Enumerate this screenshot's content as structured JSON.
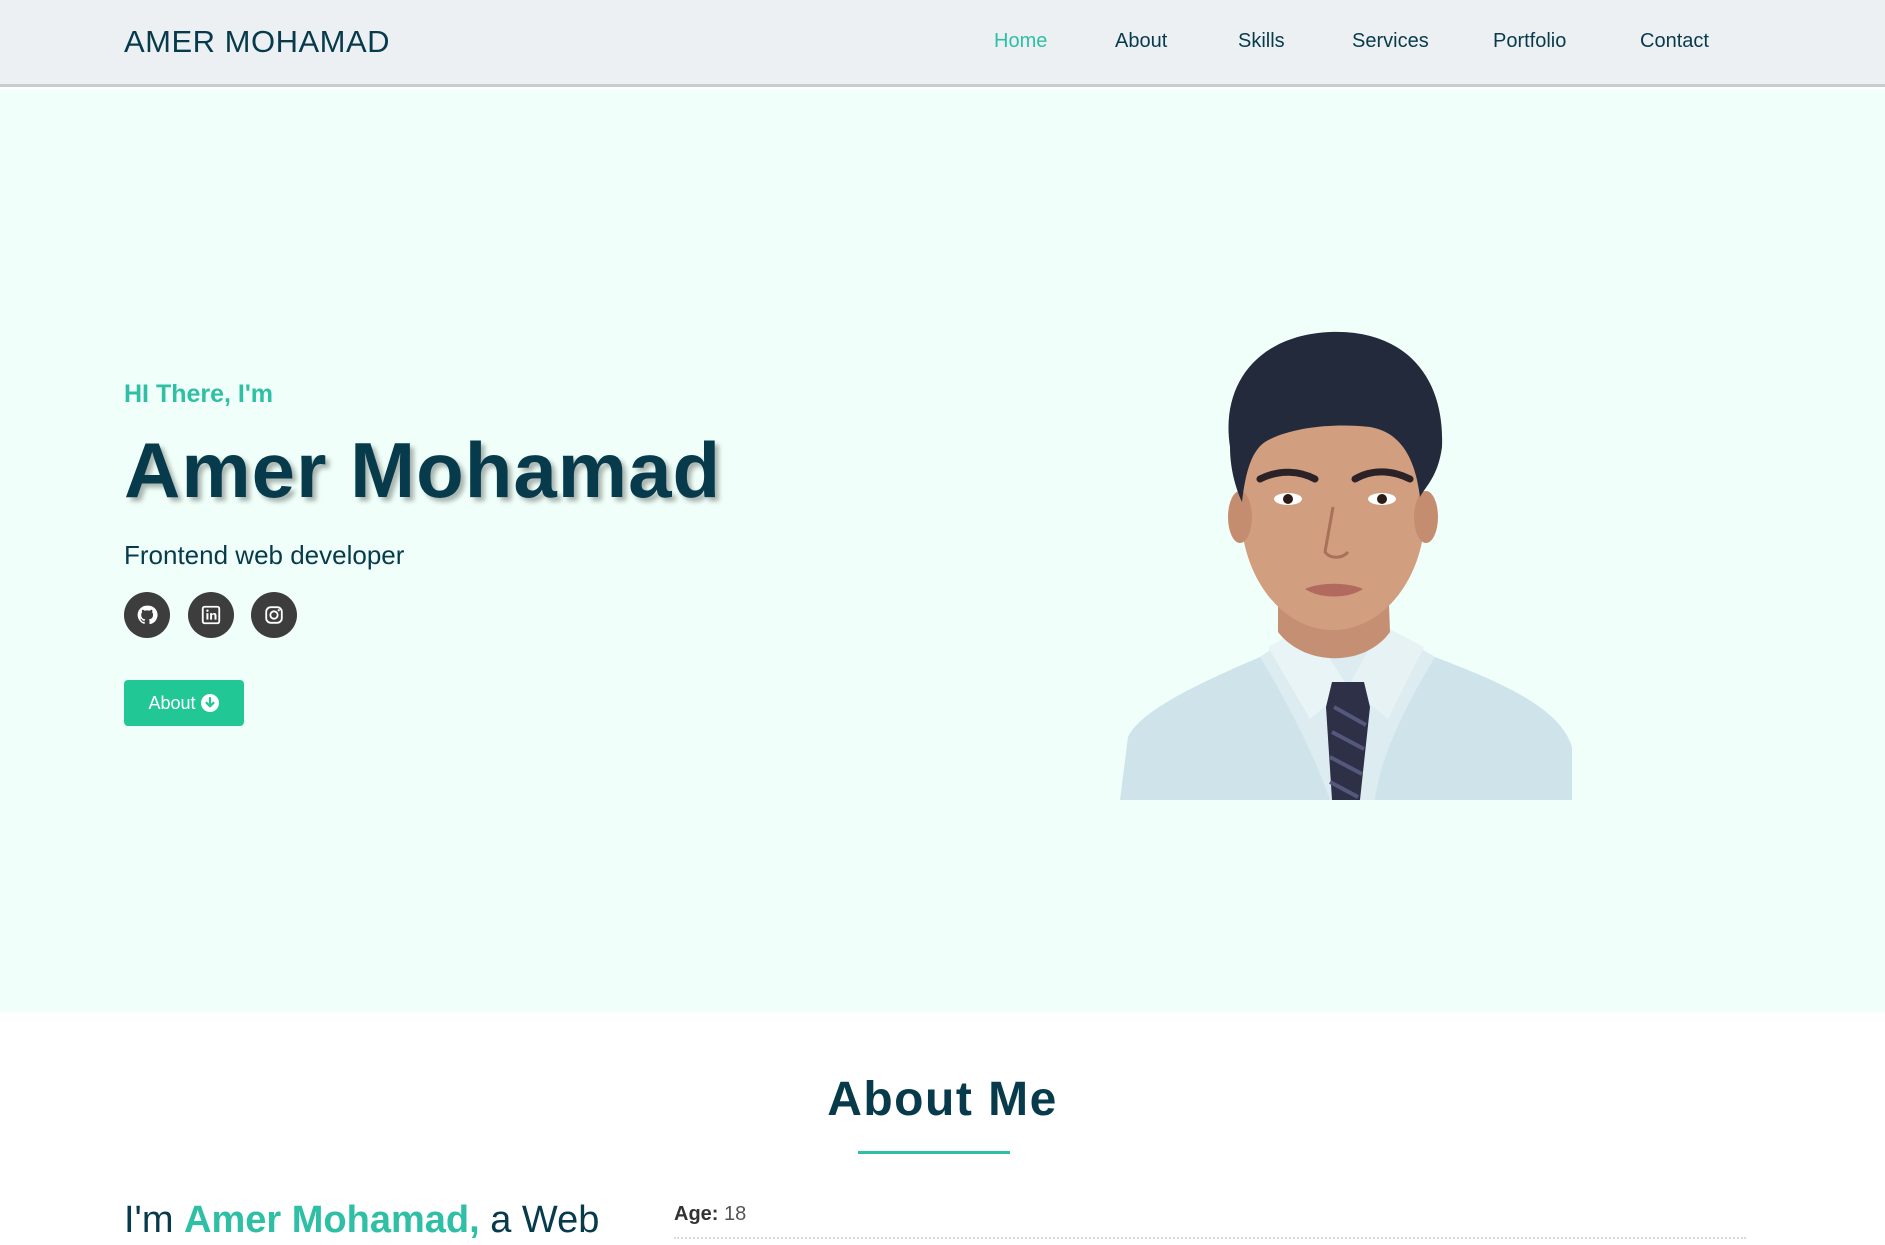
{
  "navbar": {
    "brand": "AMER MOHAMAD",
    "links": [
      {
        "label": "Home",
        "active": true
      },
      {
        "label": "About",
        "active": false
      },
      {
        "label": "Skills",
        "active": false
      },
      {
        "label": "Services",
        "active": false
      },
      {
        "label": "Portfolio",
        "active": false
      },
      {
        "label": "Contact",
        "active": false
      }
    ]
  },
  "hero": {
    "greeting": "HI There, I'm",
    "name": "Amer Mohamad",
    "role": "Frontend web developer",
    "socials": [
      {
        "icon": "github-icon"
      },
      {
        "icon": "linkedin-icon"
      },
      {
        "icon": "instagram-icon"
      }
    ],
    "about_button": {
      "label": "About",
      "icon": "arrow-down-circle-icon"
    }
  },
  "about": {
    "title": "About Me",
    "intro_prefix": "I'm",
    "intro_name": "Amer Mohamad,",
    "intro_suffix": "a Web",
    "info": {
      "age_label": "Age:",
      "age_value": "18"
    }
  },
  "colors": {
    "accent": "#2ebfa5",
    "dark": "#073b4c",
    "button": "#21c896",
    "hero_bg": "#f0fff9",
    "nav_bg": "#edf0f3"
  }
}
